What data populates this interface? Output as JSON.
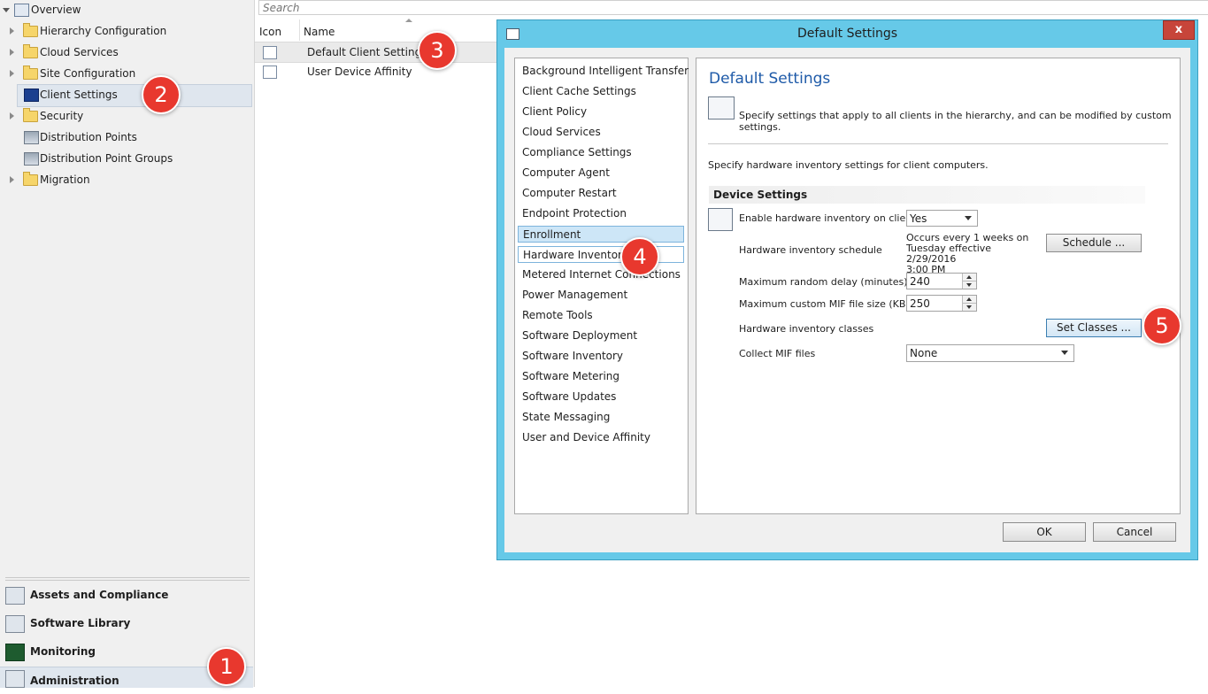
{
  "nav": {
    "tree": [
      {
        "label": "Overview",
        "icon": "overview-icon"
      },
      {
        "label": "Hierarchy Configuration",
        "icon": "folder-icon"
      },
      {
        "label": "Cloud Services",
        "icon": "folder-icon"
      },
      {
        "label": "Site Configuration",
        "icon": "folder-icon"
      },
      {
        "label": "Client Settings",
        "icon": "client-settings-icon"
      },
      {
        "label": "Security",
        "icon": "folder-icon"
      },
      {
        "label": "Distribution Points",
        "icon": "distribution-points-icon"
      },
      {
        "label": "Distribution Point Groups",
        "icon": "distribution-point-groups-icon"
      },
      {
        "label": "Migration",
        "icon": "folder-icon"
      }
    ],
    "workspaces": [
      {
        "label": "Assets and Compliance",
        "icon": "assets-compliance-icon"
      },
      {
        "label": "Software Library",
        "icon": "software-library-icon"
      },
      {
        "label": "Monitoring",
        "icon": "monitoring-icon"
      },
      {
        "label": "Administration",
        "icon": "administration-icon"
      }
    ]
  },
  "list": {
    "search_placeholder": "Search",
    "columns": [
      "Icon",
      "Name"
    ],
    "rows": [
      {
        "name": "Default Client Settings"
      },
      {
        "name": "User Device Affinity"
      }
    ]
  },
  "dialog": {
    "title": "Default Settings",
    "close_glyph": "x",
    "categories": [
      "Background Intelligent Transfer",
      "Client Cache Settings",
      "Client Policy",
      "Cloud Services",
      "Compliance Settings",
      "Computer Agent",
      "Computer Restart",
      "Endpoint Protection",
      "Enrollment",
      "Hardware Inventory",
      "Metered Internet Connections",
      "Power Management",
      "Remote Tools",
      "Software Deployment",
      "Software Inventory",
      "Software Metering",
      "Software Updates",
      "State Messaging",
      "User and Device Affinity"
    ],
    "heading": "Default Settings",
    "description": "Specify settings that apply to all clients in the hierarchy, and can be modified by custom settings.",
    "hw_description": "Specify hardware inventory settings for client computers.",
    "group_title": "Device Settings",
    "fields": {
      "enable_label": "Enable hardware inventory on clients",
      "enable_value": "Yes",
      "schedule_label": "Hardware inventory schedule",
      "schedule_text_1": "Occurs every 1 weeks on",
      "schedule_text_2": "Tuesday effective 2/29/2016",
      "schedule_text_3": "3:00 PM",
      "schedule_button": "Schedule ...",
      "delay_label": "Maximum random delay (minutes)",
      "delay_value": "240",
      "mif_size_label": "Maximum custom MIF file size (KB)",
      "mif_size_value": "250",
      "classes_label": "Hardware inventory classes",
      "classes_button": "Set Classes ...",
      "collect_label": "Collect MIF files",
      "collect_value": "None"
    },
    "ok": "OK",
    "cancel": "Cancel"
  },
  "callouts": [
    "1",
    "2",
    "3",
    "4",
    "5"
  ]
}
